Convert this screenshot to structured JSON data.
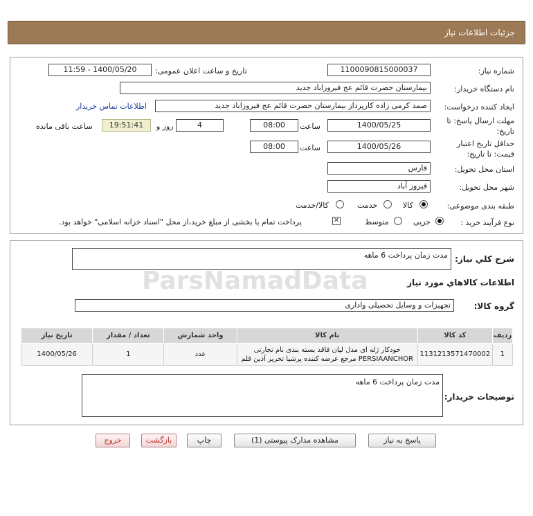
{
  "header": {
    "title": "جزئیات اطلاعات نیاز"
  },
  "watermark": {
    "text": "ParsNamadData"
  },
  "form": {
    "need_number": {
      "label": "شماره نیاز:",
      "value": "1100090815000037"
    },
    "announce": {
      "label": "تاریخ و ساعت اعلان عمومی:",
      "value": "1400/05/20 - 11:59"
    },
    "buyer_org": {
      "label": "نام دستگاه خریدار:",
      "value": "بیمارستان حضرت قائم  عج  فیروزاباد جدید"
    },
    "requester": {
      "label": "ایجاد کننده درخواست:",
      "value": "صمد کرمی زاده کارپرداز بیمارستان حضرت قائم  عج  فیروزاباد جدید",
      "contact_link": "اطلاعات تماس خریدار"
    },
    "reply_deadline": {
      "label_line1": "مهلت ارسال پاسخ: تا",
      "label_line2": "تاریخ:",
      "date": "1400/05/25",
      "time_label": "ساعت",
      "time": "08:00",
      "days": "4",
      "days_label": "روز و",
      "remaining": "19:51:41",
      "remaining_label": "ساعت باقی مانده"
    },
    "price_validity": {
      "label_line1": "حداقل تاریخ اعتبار",
      "label_line2": "قیمت: تا تاریخ:",
      "date": "1400/05/26",
      "time_label": "ساعت",
      "time": "08:00"
    },
    "province": {
      "label": "استان محل تحویل:",
      "value": "فارس"
    },
    "city": {
      "label": "شهر محل تحویل:",
      "value": "فیروز آباد"
    },
    "category": {
      "label": "طبقه بندی موضوعی:",
      "options": [
        "کالا",
        "خدمت",
        "کالا/خدمت"
      ],
      "selected": "کالا"
    },
    "process": {
      "label": "نوع فرآیند خرید :",
      "options": [
        "جزیی",
        "متوسط"
      ],
      "selected": "جزیی",
      "note": "پرداخت تمام یا بخشی از مبلغ خرید،از محل \"اسناد خزانه اسلامی\" خواهد بود."
    }
  },
  "description": {
    "label": "شرح کلي نياز:",
    "value": "مدت زمان پرداخت 6 ماهه",
    "goods_info_title": "اطلاعات کالاهاي مورد نياز",
    "goods_group_label": "گروه کالا:",
    "goods_group_value": "تجهیزات و وسایل تحصیلی واداری"
  },
  "table": {
    "headers": [
      "ردیف",
      "کد کالا",
      "نام کالا",
      "واحد شمارش",
      "تعداد / مقدار",
      "تاریخ نیاز"
    ],
    "rows": [
      {
        "index": "1",
        "code": "1131213571470002",
        "name_line1": "خودکار ژله ای مدل لیان فاقد بسته بندی نام تجارتی",
        "name_line2": "PERSIAANCHOR مرجع عرضه کننده پرشیا تحریر آذین قلم",
        "unit": "عدد",
        "qty": "1",
        "date": "1400/05/26"
      }
    ]
  },
  "buyer_notes": {
    "label": "توضیحات خریدار:",
    "value": "مدت زمان پرداخت 6 ماهه"
  },
  "buttons": {
    "reply": "پاسخ به نیاز",
    "attachments": "مشاهده مدارک پیوستی (1)",
    "print": "چاپ",
    "back": "بازگشت",
    "exit": "خروج"
  }
}
